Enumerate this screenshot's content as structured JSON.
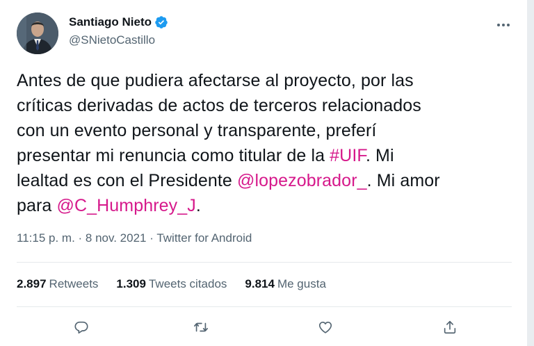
{
  "author": {
    "name": "Santiago Nieto",
    "handle": "@SNietoCastillo",
    "verified_icon": "verified-badge-icon"
  },
  "tweet": {
    "lines": [
      [
        {
          "text": "Antes de que pudiera afectarse al proyecto, por las",
          "link": false
        }
      ],
      [
        {
          "text": "críticas derivadas de actos de terceros relacionados",
          "link": false
        }
      ],
      [
        {
          "text": "con un evento personal y transparente, preferí",
          "link": false
        }
      ],
      [
        {
          "text": "presentar mi renuncia como titular de la ",
          "link": false
        },
        {
          "text": "#UIF",
          "link": true
        },
        {
          "text": ". Mi",
          "link": false
        }
      ],
      [
        {
          "text": "lealtad es con el Presidente ",
          "link": false
        },
        {
          "text": "@lopezobrador_",
          "link": true
        },
        {
          "text": ". Mi amor",
          "link": false
        }
      ],
      [
        {
          "text": "para ",
          "link": false
        },
        {
          "text": "@C_Humphrey_J",
          "link": true
        },
        {
          "text": ".",
          "link": false
        }
      ]
    ]
  },
  "meta": {
    "time": "11:15 p. m.",
    "separator1": " · ",
    "date": "8 nov. 2021",
    "separator2": " · ",
    "source": "Twitter for Android"
  },
  "stats": {
    "retweets_count": "2.897",
    "retweets_label": "Retweets",
    "quotes_count": "1.309",
    "quotes_label": "Tweets citados",
    "likes_count": "9.814",
    "likes_label": "Me gusta"
  },
  "actions": [
    "reply-icon",
    "retweet-icon",
    "like-icon",
    "share-icon"
  ],
  "colors": {
    "link": "#d6198b",
    "secondary_text": "#536471",
    "primary_text": "#0f1419",
    "verified": "#1d9bf0",
    "divider": "#e5e9ec"
  }
}
